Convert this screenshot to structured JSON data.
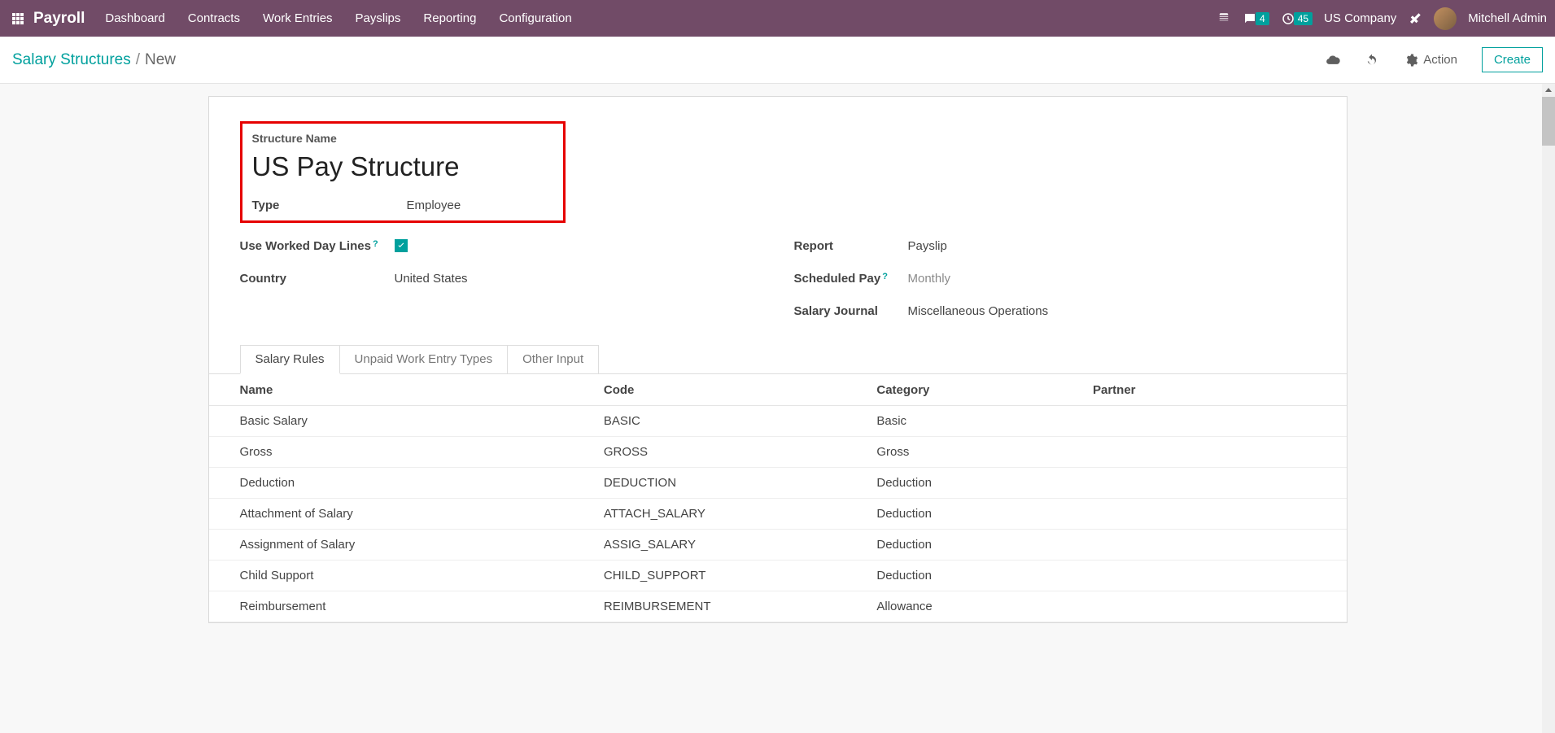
{
  "topbar": {
    "brand": "Payroll",
    "menu": [
      "Dashboard",
      "Contracts",
      "Work Entries",
      "Payslips",
      "Reporting",
      "Configuration"
    ],
    "chat_badge": "4",
    "clock_badge": "45",
    "company": "US Company",
    "user": "Mitchell Admin"
  },
  "breadcrumb": {
    "root": "Salary Structures",
    "current": "New",
    "action_label": "Action",
    "create_label": "Create"
  },
  "form": {
    "structure_name_label": "Structure Name",
    "structure_name_value": "US Pay Structure",
    "type_label": "Type",
    "type_value": "Employee",
    "worked_lines_label": "Use Worked Day Lines",
    "worked_lines_checked": true,
    "country_label": "Country",
    "country_value": "United States",
    "report_label": "Report",
    "report_value": "Payslip",
    "scheduled_pay_label": "Scheduled Pay",
    "scheduled_pay_value": "Monthly",
    "salary_journal_label": "Salary Journal",
    "salary_journal_value": "Miscellaneous Operations"
  },
  "tabs": [
    "Salary Rules",
    "Unpaid Work Entry Types",
    "Other Input"
  ],
  "table": {
    "headers": {
      "name": "Name",
      "code": "Code",
      "category": "Category",
      "partner": "Partner"
    },
    "rows": [
      {
        "name": "Basic Salary",
        "code": "BASIC",
        "category": "Basic",
        "partner": ""
      },
      {
        "name": "Gross",
        "code": "GROSS",
        "category": "Gross",
        "partner": ""
      },
      {
        "name": "Deduction",
        "code": "DEDUCTION",
        "category": "Deduction",
        "partner": ""
      },
      {
        "name": "Attachment of Salary",
        "code": "ATTACH_SALARY",
        "category": "Deduction",
        "partner": ""
      },
      {
        "name": "Assignment of Salary",
        "code": "ASSIG_SALARY",
        "category": "Deduction",
        "partner": ""
      },
      {
        "name": "Child Support",
        "code": "CHILD_SUPPORT",
        "category": "Deduction",
        "partner": ""
      },
      {
        "name": "Reimbursement",
        "code": "REIMBURSEMENT",
        "category": "Allowance",
        "partner": ""
      }
    ]
  }
}
